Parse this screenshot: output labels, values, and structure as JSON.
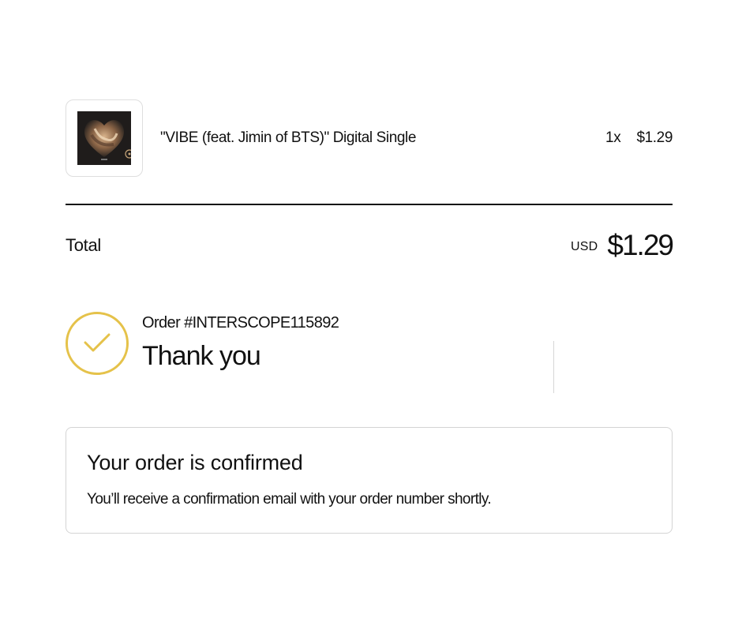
{
  "cart": {
    "item_name": "\"VIBE (feat. Jimin of BTS)\" Digital Single",
    "item_qty": "1x",
    "item_price": "$1.29",
    "total_label": "Total",
    "currency": "USD",
    "total_amount": "$1.29"
  },
  "order": {
    "number": "Order #INTERSCOPE115892",
    "thank_you": "Thank you"
  },
  "confirmation": {
    "title": "Your order is confirmed",
    "message": "You’ll receive a confirmation email with your order number shortly."
  },
  "colors": {
    "accent": "#e5c24a",
    "text": "#111111",
    "border": "#d4d4d4"
  },
  "icons": {
    "status": "check-icon",
    "album": "album-cover"
  }
}
